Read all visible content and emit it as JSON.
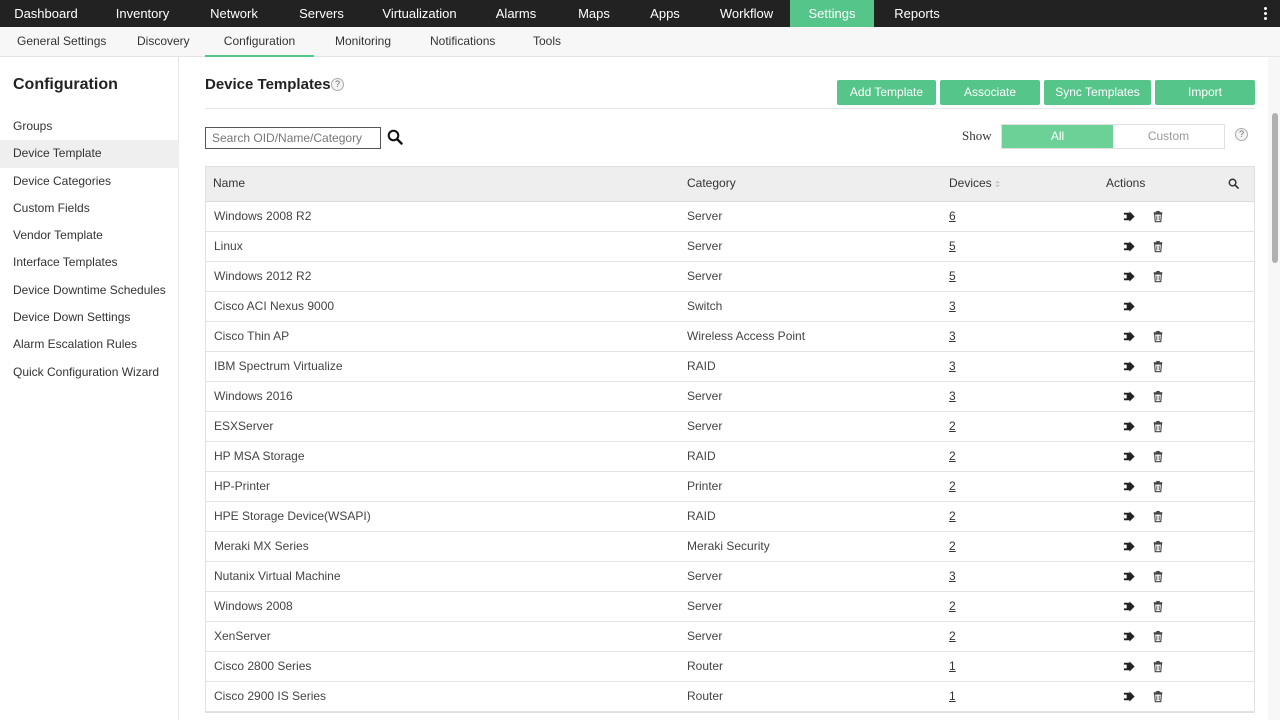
{
  "topnav": {
    "items": [
      {
        "label": "Dashboard",
        "active": false
      },
      {
        "label": "Inventory",
        "active": false
      },
      {
        "label": "Network",
        "active": false
      },
      {
        "label": "Servers",
        "active": false
      },
      {
        "label": "Virtualization",
        "active": false
      },
      {
        "label": "Alarms",
        "active": false
      },
      {
        "label": "Maps",
        "active": false
      },
      {
        "label": "Apps",
        "active": false
      },
      {
        "label": "Workflow",
        "active": false
      },
      {
        "label": "Settings",
        "active": true
      },
      {
        "label": "Reports",
        "active": false
      }
    ]
  },
  "subnav": {
    "items": [
      {
        "label": "General Settings",
        "active": false
      },
      {
        "label": "Discovery",
        "active": false
      },
      {
        "label": "Configuration",
        "active": true
      },
      {
        "label": "Monitoring",
        "active": false
      },
      {
        "label": "Notifications",
        "active": false
      },
      {
        "label": "Tools",
        "active": false
      }
    ]
  },
  "sidebar": {
    "title": "Configuration",
    "items": [
      {
        "label": "Groups",
        "active": false
      },
      {
        "label": "Device Template",
        "active": true
      },
      {
        "label": "Device Categories",
        "active": false
      },
      {
        "label": "Custom Fields",
        "active": false
      },
      {
        "label": "Vendor Template",
        "active": false
      },
      {
        "label": "Interface Templates",
        "active": false
      },
      {
        "label": "Device Downtime Schedules",
        "active": false
      },
      {
        "label": "Device Down Settings",
        "active": false
      },
      {
        "label": "Alarm Escalation Rules",
        "active": false
      },
      {
        "label": "Quick Configuration Wizard",
        "active": false
      }
    ]
  },
  "main": {
    "title": "Device Templates",
    "help_glyph": "?",
    "buttons": {
      "add_template": "Add Template",
      "associate": "Associate",
      "sync_templates": "Sync Templates",
      "import": "Import"
    },
    "search": {
      "placeholder": "Search OID/Name/Category",
      "value": ""
    },
    "show": {
      "label": "Show",
      "options": [
        "All",
        "Custom"
      ],
      "selected": "All"
    },
    "table": {
      "headers": {
        "name": "Name",
        "category": "Category",
        "devices": "Devices",
        "actions": "Actions"
      },
      "rows": [
        {
          "name": "Windows 2008 R2",
          "category": "Server",
          "devices": "6",
          "deletable": true
        },
        {
          "name": "Linux",
          "category": "Server",
          "devices": "5",
          "deletable": true
        },
        {
          "name": "Windows 2012 R2",
          "category": "Server",
          "devices": "5",
          "deletable": true
        },
        {
          "name": "Cisco ACI Nexus 9000",
          "category": "Switch",
          "devices": "3",
          "deletable": false
        },
        {
          "name": "Cisco Thin AP",
          "category": "Wireless Access Point",
          "devices": "3",
          "deletable": true
        },
        {
          "name": "IBM Spectrum Virtualize",
          "category": "RAID",
          "devices": "3",
          "deletable": true
        },
        {
          "name": "Windows 2016",
          "category": "Server",
          "devices": "3",
          "deletable": true
        },
        {
          "name": "ESXServer",
          "category": "Server",
          "devices": "2",
          "deletable": true
        },
        {
          "name": "HP MSA Storage",
          "category": "RAID",
          "devices": "2",
          "deletable": true
        },
        {
          "name": "HP-Printer",
          "category": "Printer",
          "devices": "2",
          "deletable": true
        },
        {
          "name": "HPE Storage Device(WSAPI)",
          "category": "RAID",
          "devices": "2",
          "deletable": true
        },
        {
          "name": "Meraki MX Series",
          "category": "Meraki Security",
          "devices": "2",
          "deletable": true
        },
        {
          "name": "Nutanix Virtual Machine",
          "category": "Server",
          "devices": "3",
          "deletable": true
        },
        {
          "name": "Windows 2008",
          "category": "Server",
          "devices": "2",
          "deletable": true
        },
        {
          "name": "XenServer",
          "category": "Server",
          "devices": "2",
          "deletable": true
        },
        {
          "name": "Cisco 2800 Series",
          "category": "Router",
          "devices": "1",
          "deletable": true
        },
        {
          "name": "Cisco 2900 IS Series",
          "category": "Router",
          "devices": "1",
          "deletable": true
        }
      ]
    }
  },
  "icons": {
    "export": "export-icon",
    "delete": "trash-icon",
    "search": "search-icon",
    "sort": "sort-icon",
    "more": "more-vertical-icon"
  },
  "colors": {
    "accent": "#55c58a",
    "topbar": "#222222"
  }
}
